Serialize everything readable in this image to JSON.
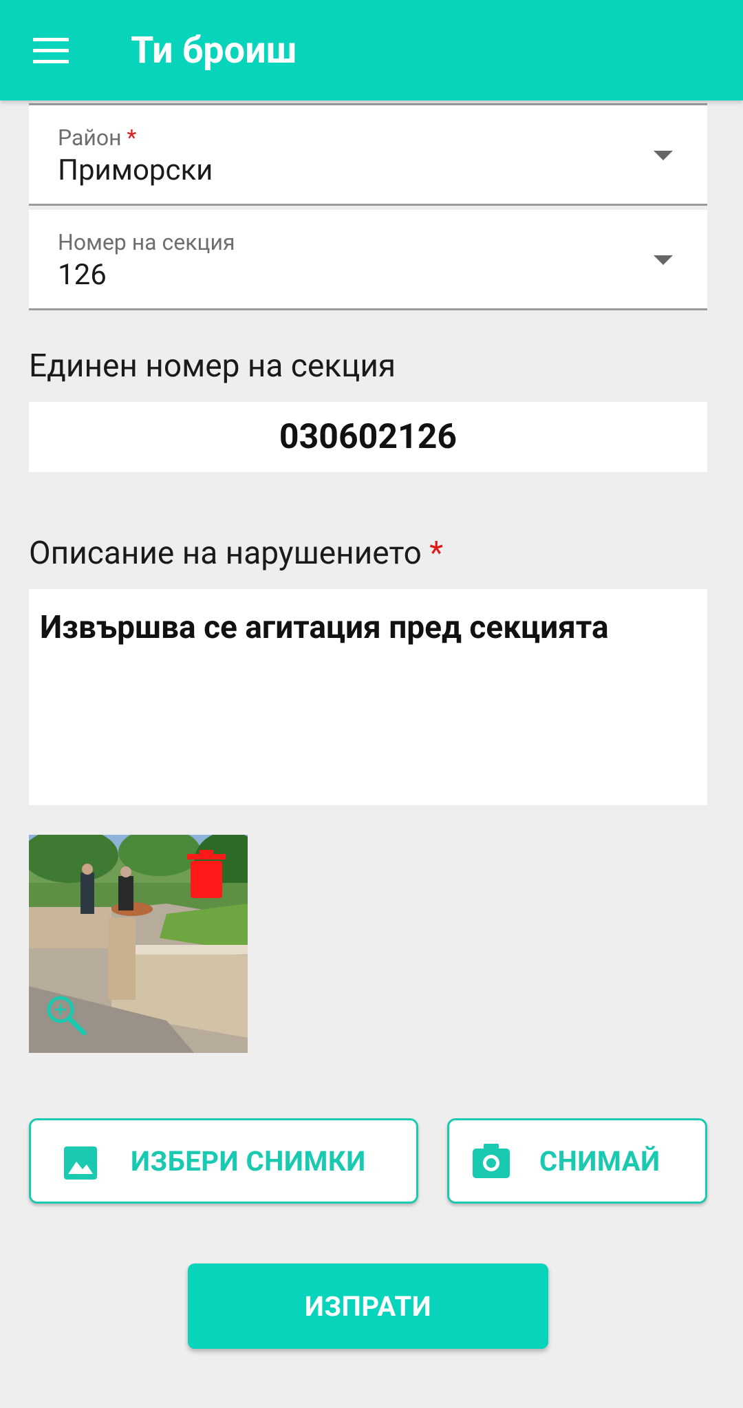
{
  "app": {
    "title": "Ти броиш"
  },
  "colors": {
    "accent": "#08d4bb",
    "required": "#e01818",
    "background": "#eeeeee"
  },
  "form": {
    "district": {
      "label": "Район",
      "required_mark": "*",
      "value": "Приморски"
    },
    "section_number": {
      "label": "Номер на секция",
      "value": "126"
    },
    "unique_section": {
      "label": "Единен номер на секция",
      "value": "030602126"
    },
    "description": {
      "label": "Описание на нарушението",
      "required_mark": "*",
      "value": "Извършва се агитация пред секцията"
    }
  },
  "photo": {
    "delete_icon": "trash-icon",
    "zoom_icon": "zoom-in-icon"
  },
  "buttons": {
    "choose_photos": {
      "label": "ИЗБЕРИ СНИМКИ",
      "icon": "image-icon"
    },
    "take_photo": {
      "label": "СНИМАЙ",
      "icon": "camera-icon"
    },
    "send": {
      "label": "ИЗПРАТИ"
    }
  }
}
